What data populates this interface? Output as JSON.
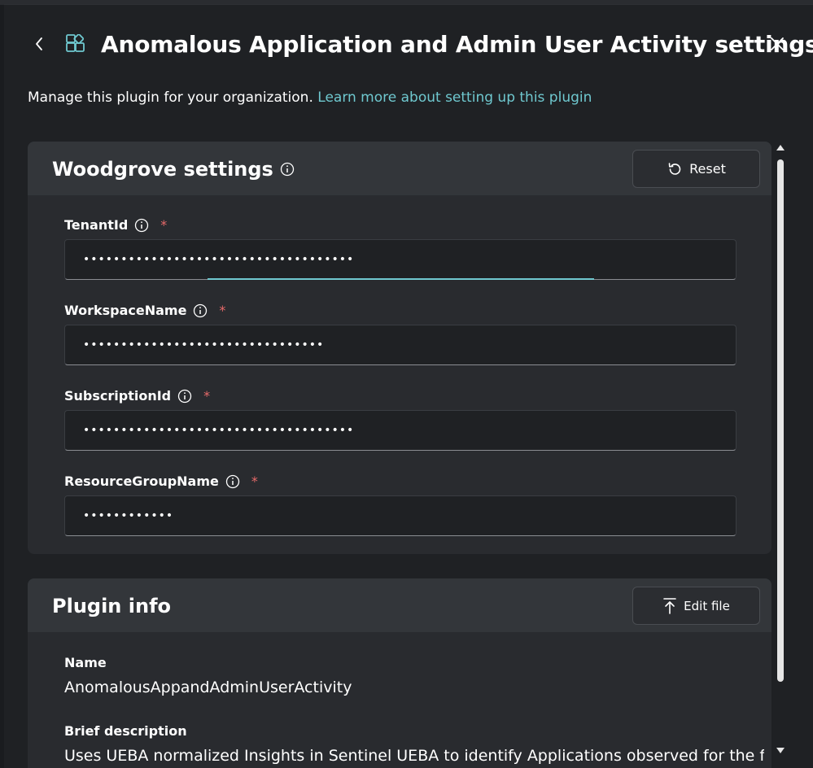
{
  "header": {
    "title": "Anomalous Application and Admin User Activity settings",
    "back_icon": "chevron-left-icon",
    "plugin_icon": "plugin-grid-icon",
    "close_icon": "close-icon"
  },
  "intro": {
    "text": "Manage this plugin for your organization.",
    "link": "Learn more about setting up this plugin"
  },
  "settings_card": {
    "title": "Woodgrove settings",
    "reset_label": "Reset",
    "fields": [
      {
        "label": "TenantId",
        "value": "••••••••••••••••••••••••••••••••••••"
      },
      {
        "label": "WorkspaceName",
        "value": "••••••••••••••••••••••••••••••••"
      },
      {
        "label": "SubscriptionId",
        "value": "••••••••••••••••••••••••••••••••••••"
      },
      {
        "label": "ResourceGroupName",
        "value": "••••••••••••"
      }
    ],
    "required_mark": "*"
  },
  "plugin_card": {
    "title": "Plugin info",
    "edit_label": "Edit file",
    "name_label": "Name",
    "name_value": "AnomalousAppandAdminUserActivity",
    "desc_label": "Brief description",
    "desc_value": "Uses UEBA normalized Insights in Sentinel UEBA to identify Applications observed for the first"
  },
  "colors": {
    "accent": "#6fc8cf",
    "required": "#e86a6a",
    "background": "#1f2124"
  }
}
